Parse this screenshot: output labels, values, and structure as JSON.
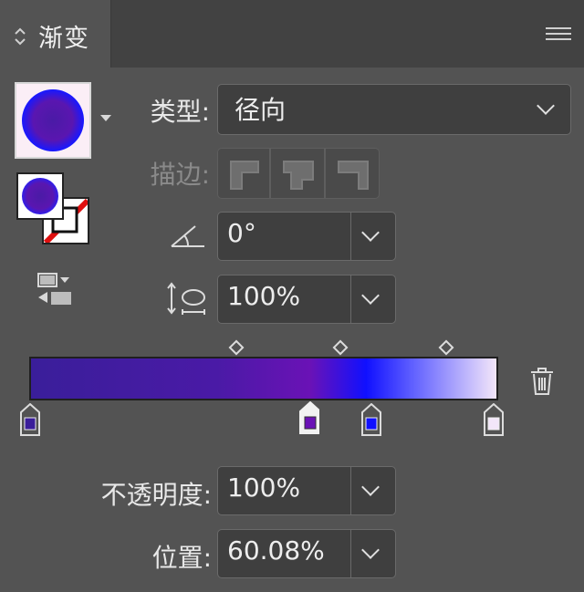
{
  "panel": {
    "tab_title": "渐变"
  },
  "type": {
    "label": "类型:",
    "value": "径向"
  },
  "stroke": {
    "label": "描边:"
  },
  "angle": {
    "value": "0°"
  },
  "aspect": {
    "value": "100%"
  },
  "opacity": {
    "label": "不透明度:",
    "value": "100%"
  },
  "location": {
    "label": "位置:",
    "value": "60.08%"
  },
  "gradient": {
    "stops": [
      {
        "position": 0.0,
        "color": "#3a1e9a"
      },
      {
        "position": 0.6008,
        "color": "#6a12b6"
      },
      {
        "position": 0.72,
        "color": "#1010ff"
      },
      {
        "position": 1.0,
        "color": "#f3e6fa"
      }
    ],
    "midpoints": [
      0.45,
      0.67,
      0.89
    ],
    "selected_stop": 1
  },
  "colors": {
    "panel_bg": "#535353",
    "header_bg": "#424242",
    "field_bg": "#3f3f3f",
    "accent_red": "#e01010"
  },
  "icons": {
    "panel_menu": "hamburger-icon",
    "angle": "angle-icon",
    "aspect": "aspect-ratio-icon",
    "delete": "trash-icon",
    "reverse": "reverse-gradient-icon"
  }
}
